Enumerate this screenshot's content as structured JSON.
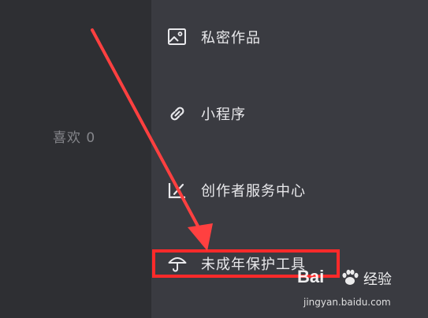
{
  "left_panel": {
    "likes_label": "喜欢 0"
  },
  "menu": {
    "items": [
      {
        "label": "私密作品",
        "icon": "image-icon"
      },
      {
        "label": "小程序",
        "icon": "link-icon"
      },
      {
        "label": "创作者服务中心",
        "icon": "chart-icon"
      },
      {
        "label": "未成年保护工具",
        "icon": "umbrella-icon"
      }
    ]
  },
  "annotation": {
    "highlight_color": "#ff2a2a",
    "highlighted_item": "未成年保护工具"
  },
  "watermark": {
    "logo_text": "Bai",
    "brand_text": "经验",
    "url": "jingyan.baidu.com"
  }
}
